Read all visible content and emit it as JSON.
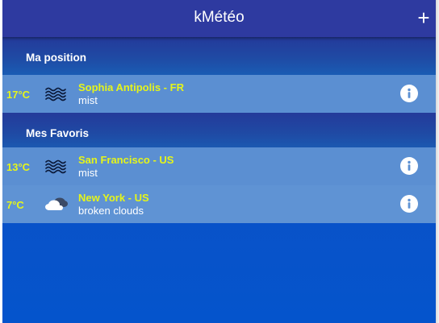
{
  "app": {
    "title": "kMétéo",
    "add_icon": "plus-icon"
  },
  "sections": [
    {
      "title": "Ma position"
    },
    {
      "title": "Mes Favoris"
    }
  ],
  "locations": [
    {
      "temp": "17°C",
      "city": "Sophia Antipolis - FR",
      "desc": "mist",
      "icon": "mist-icon"
    },
    {
      "temp": "13°C",
      "city": "San Francisco - US",
      "desc": "mist",
      "icon": "mist-icon"
    },
    {
      "temp": "7°C",
      "city": "New York - US",
      "desc": "broken clouds",
      "icon": "broken-clouds-icon"
    }
  ],
  "colors": {
    "appbar": "#2e3aa0",
    "accent_text": "#e5f51a",
    "row": "#5b8fd2",
    "background": "#0a52c8"
  }
}
